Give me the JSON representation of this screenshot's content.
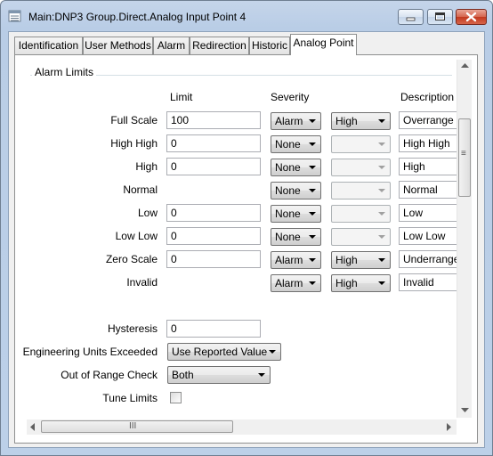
{
  "window": {
    "title": "Main:DNP3 Group.Direct.Analog Input Point 4",
    "icon": "table-icon"
  },
  "tabs": [
    {
      "label": "Identification",
      "active": false
    },
    {
      "label": "User Methods",
      "active": false
    },
    {
      "label": "Alarm",
      "active": false
    },
    {
      "label": "Redirection",
      "active": false
    },
    {
      "label": "Historic",
      "active": false
    },
    {
      "label": "Analog Point",
      "active": true
    }
  ],
  "alarm_limits": {
    "group_label": "Alarm Limits",
    "headers": {
      "limit": "Limit",
      "severity": "Severity",
      "description": "Description"
    },
    "rows": [
      {
        "label": "Full Scale",
        "limit": "100",
        "severity": "Alarm",
        "priority": "High",
        "priority_enabled": true,
        "description": "Overrange"
      },
      {
        "label": "High High",
        "limit": "0",
        "severity": "None",
        "priority": "",
        "priority_enabled": false,
        "description": "High High"
      },
      {
        "label": "High",
        "limit": "0",
        "severity": "None",
        "priority": "",
        "priority_enabled": false,
        "description": "High"
      },
      {
        "label": "Normal",
        "limit": null,
        "severity": "None",
        "priority": "",
        "priority_enabled": false,
        "description": "Normal"
      },
      {
        "label": "Low",
        "limit": "0",
        "severity": "None",
        "priority": "",
        "priority_enabled": false,
        "description": "Low"
      },
      {
        "label": "Low Low",
        "limit": "0",
        "severity": "None",
        "priority": "",
        "priority_enabled": false,
        "description": "Low Low"
      },
      {
        "label": "Zero Scale",
        "limit": "0",
        "severity": "Alarm",
        "priority": "High",
        "priority_enabled": true,
        "description": "Underrange"
      },
      {
        "label": "Invalid",
        "limit": null,
        "severity": "Alarm",
        "priority": "High",
        "priority_enabled": true,
        "description": "Invalid"
      }
    ]
  },
  "hysteresis": {
    "label": "Hysteresis",
    "value": "0"
  },
  "engineering_units": {
    "label": "Engineering Units Exceeded",
    "value": "Use Reported Value"
  },
  "out_of_range": {
    "label": "Out of Range Check",
    "value": "Both"
  },
  "tune_limits": {
    "label": "Tune Limits",
    "checked": false
  },
  "scroll": {
    "h_thumb_glyph": "III",
    "v_thumb_glyph": "≡"
  }
}
